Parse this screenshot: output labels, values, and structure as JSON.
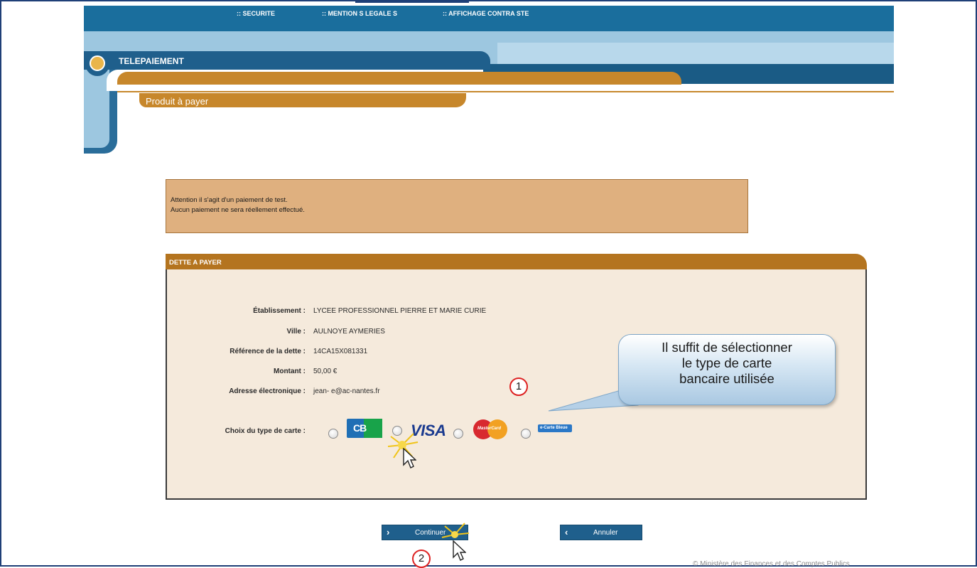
{
  "topnav": {
    "items": [
      ":: SECURITE",
      ":: MENTION S LEGALE S",
      ":: AFFICHAGE CONTRA STE"
    ]
  },
  "header": {
    "section_title": "TELEPAIEMENT",
    "subsection_title": "Produit à payer"
  },
  "warning": {
    "line1": "Attention il s'agit d'un paiement de test.",
    "line2": "Aucun paiement ne sera réellement effectué."
  },
  "panel": {
    "title": "DETTE A PAYER",
    "fields": [
      {
        "label": "Établissement :",
        "value": "LYCEE PROFESSIONNEL PIERRE ET MARIE CURIE"
      },
      {
        "label": "Ville :",
        "value": "AULNOYE AYMERIES"
      },
      {
        "label": "Référence de la dette :",
        "value": "14CA15X081331"
      },
      {
        "label": "Montant :",
        "value": "50,00 €"
      },
      {
        "label": "Adresse électronique :",
        "value": "jean-           e@ac-nantes.fr"
      }
    ],
    "card_choice_label": "Choix du type de carte :",
    "cards": [
      "CB",
      "VISA",
      "MasterCard",
      "e-Carte Bleue"
    ]
  },
  "callout": {
    "text": "Il suffit de sélectionner\nle type de carte\nbancaire utilisée"
  },
  "markers": {
    "step1": "1",
    "step2": "2"
  },
  "buttons": {
    "continue": "Continuer",
    "cancel": "Annuler"
  },
  "footer": {
    "copyright": "© Ministère des Finances et des Comptes Publics"
  },
  "colors": {
    "header_blue": "#1a6e9d",
    "gold": "#c7872b",
    "panel_bg": "#f5eadc",
    "warning_bg": "#dfb07f"
  }
}
